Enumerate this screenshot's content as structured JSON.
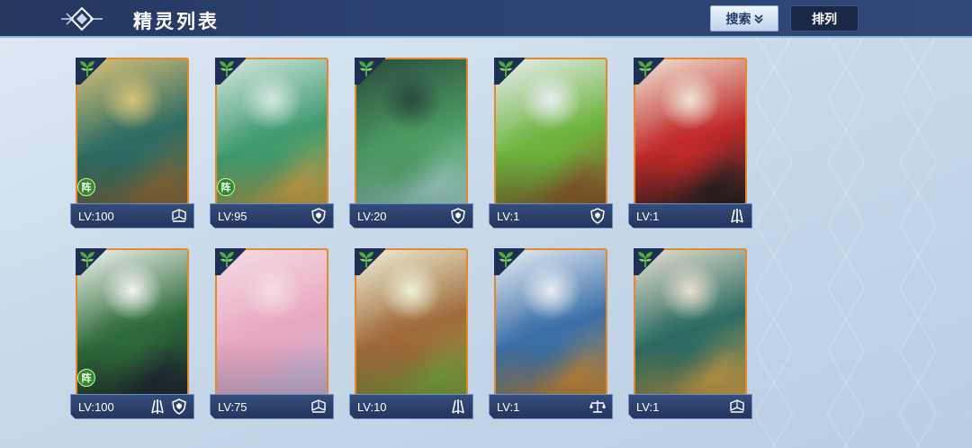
{
  "header": {
    "title": "精灵列表",
    "search_label": "搜索",
    "sort_label": "排列"
  },
  "colors": {
    "header_bg": "#2c4270",
    "card_border": "#e48a2e",
    "plate_bg": "#24355e",
    "leaf": "#4fae3a",
    "formation_badge": "#2f8c2a"
  },
  "cards": [
    {
      "level": "LV:100",
      "formation": "阵",
      "icons": [
        "book-icon"
      ],
      "art": [
        "#d9c27a",
        "#2c6b62",
        "#8a6b3a"
      ]
    },
    {
      "level": "LV:95",
      "formation": "阵",
      "icons": [
        "shield-icon"
      ],
      "art": [
        "#d5e8e2",
        "#3f9a6e",
        "#c9a34a"
      ]
    },
    {
      "level": "LV:20",
      "formation": "",
      "icons": [
        "shield-icon"
      ],
      "art": [
        "#2a4a3e",
        "#4c9a62",
        "#9fd1c9"
      ]
    },
    {
      "level": "LV:1",
      "formation": "",
      "icons": [
        "shield-icon"
      ],
      "art": [
        "#e9eef2",
        "#6db33d",
        "#8b5a2e"
      ]
    },
    {
      "level": "LV:1",
      "formation": "",
      "icons": [
        "claw-icon"
      ],
      "art": [
        "#f0e6d6",
        "#c02a2a",
        "#2a2222"
      ]
    },
    {
      "level": "LV:100",
      "formation": "阵",
      "icons": [
        "claw-icon",
        "shield-icon"
      ],
      "art": [
        "#f2f4f0",
        "#2f6b3a",
        "#1f2a33"
      ]
    },
    {
      "level": "LV:75",
      "formation": "",
      "icons": [
        "book-icon"
      ],
      "art": [
        "#f5dce6",
        "#e8a7c0",
        "#c9b3d8"
      ]
    },
    {
      "level": "LV:10",
      "formation": "",
      "icons": [
        "claw-icon"
      ],
      "art": [
        "#eef0d8",
        "#a06a3a",
        "#7ba33e"
      ]
    },
    {
      "level": "LV:1",
      "formation": "",
      "icons": [
        "scale-icon"
      ],
      "art": [
        "#e9eef4",
        "#3a6fa8",
        "#c58a3a"
      ]
    },
    {
      "level": "LV:1",
      "formation": "",
      "icons": [
        "book-icon"
      ],
      "art": [
        "#e7e0cf",
        "#2c6b62",
        "#c9a04a"
      ]
    }
  ]
}
